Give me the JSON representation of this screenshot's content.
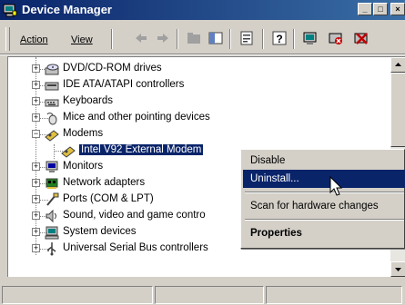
{
  "window": {
    "title": "Device Manager",
    "min_glyph": "_",
    "max_glyph": "□",
    "close_glyph": "×"
  },
  "menu": {
    "action": "Action",
    "view": "View"
  },
  "tree": {
    "items": [
      {
        "label": "DVD/CD-ROM drives",
        "icon": "dvd-drive-icon",
        "expander": "+"
      },
      {
        "label": "IDE ATA/ATAPI controllers",
        "icon": "ide-controller-icon",
        "expander": "+"
      },
      {
        "label": "Keyboards",
        "icon": "keyboard-icon",
        "expander": "+"
      },
      {
        "label": "Mice and other pointing devices",
        "icon": "mouse-icon",
        "expander": "+"
      },
      {
        "label": "Modems",
        "icon": "modem-icon",
        "expander": "−"
      },
      {
        "label": "Intel V92 External Modem",
        "icon": "modem-device-icon",
        "expander": ""
      },
      {
        "label": "Monitors",
        "icon": "monitor-icon",
        "expander": "+"
      },
      {
        "label": "Network adapters",
        "icon": "network-adapter-icon",
        "expander": "+"
      },
      {
        "label": "Ports (COM & LPT)",
        "icon": "port-icon",
        "expander": "+"
      },
      {
        "label": "Sound, video and game contro",
        "icon": "sound-icon",
        "expander": "+"
      },
      {
        "label": "System devices",
        "icon": "system-device-icon",
        "expander": "+"
      },
      {
        "label": "Universal Serial Bus controllers",
        "icon": "usb-icon",
        "expander": "+"
      }
    ]
  },
  "context_menu": {
    "disable": "Disable",
    "uninstall": "Uninstall...",
    "scan": "Scan for hardware changes",
    "properties": "Properties"
  },
  "colors": {
    "selection": "#0a246a",
    "title_start": "#0a246a",
    "title_end": "#3a6ea5"
  }
}
